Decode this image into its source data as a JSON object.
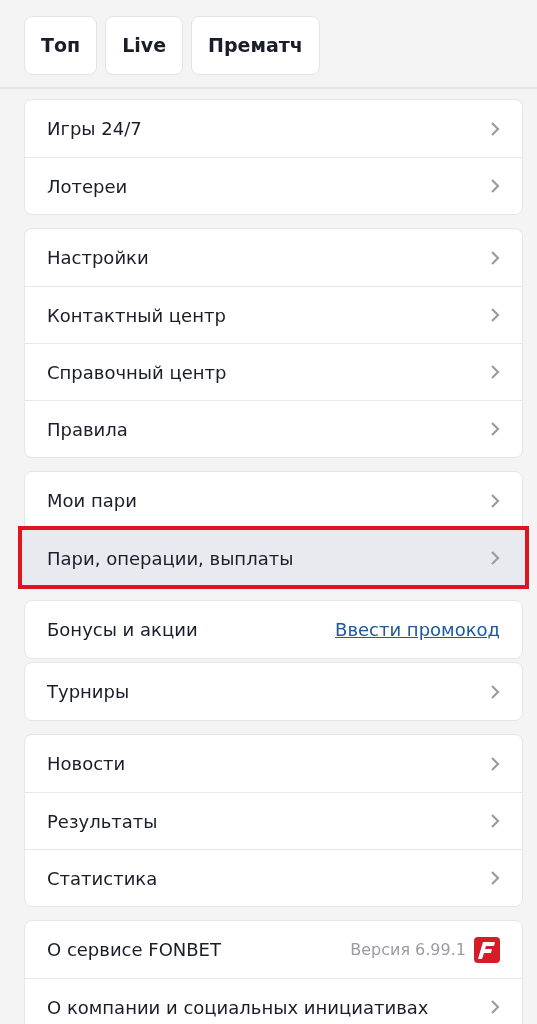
{
  "tabs": [
    {
      "label": "Топ"
    },
    {
      "label": "Live"
    },
    {
      "label": "Прематч"
    }
  ],
  "groups": [
    {
      "items": [
        {
          "kind": "chevron",
          "label": "Игры 24/7",
          "highlighted": false
        },
        {
          "kind": "chevron",
          "label": "Лотереи",
          "highlighted": false
        }
      ]
    },
    {
      "items": [
        {
          "kind": "chevron",
          "label": "Настройки",
          "highlighted": false
        },
        {
          "kind": "chevron",
          "label": "Контактный центр",
          "highlighted": false
        },
        {
          "kind": "chevron",
          "label": "Справочный центр",
          "highlighted": false
        },
        {
          "kind": "chevron",
          "label": "Правила",
          "highlighted": false
        }
      ]
    },
    {
      "items": [
        {
          "kind": "chevron",
          "label": "Мои пари",
          "highlighted": false
        },
        {
          "kind": "chevron",
          "label": "Пари, операции, выплаты",
          "highlighted": true
        }
      ]
    },
    {
      "items": [
        {
          "kind": "link",
          "label": "Бонусы и акции",
          "link": "Ввести промокод",
          "highlighted": false
        }
      ]
    },
    {
      "items": [
        {
          "kind": "chevron",
          "label": "Турниры",
          "highlighted": false
        }
      ]
    },
    {
      "items": [
        {
          "kind": "chevron",
          "label": "Новости",
          "highlighted": false
        },
        {
          "kind": "chevron",
          "label": "Результаты",
          "highlighted": false
        },
        {
          "kind": "chevron",
          "label": "Статистика",
          "highlighted": false
        }
      ]
    },
    {
      "items": [
        {
          "kind": "version",
          "label": "О сервисе FONBET",
          "version": "Версия 6.99.1",
          "highlighted": false
        },
        {
          "kind": "chevron",
          "label": "О компании и социальных инициативах",
          "highlighted": false
        }
      ]
    }
  ]
}
